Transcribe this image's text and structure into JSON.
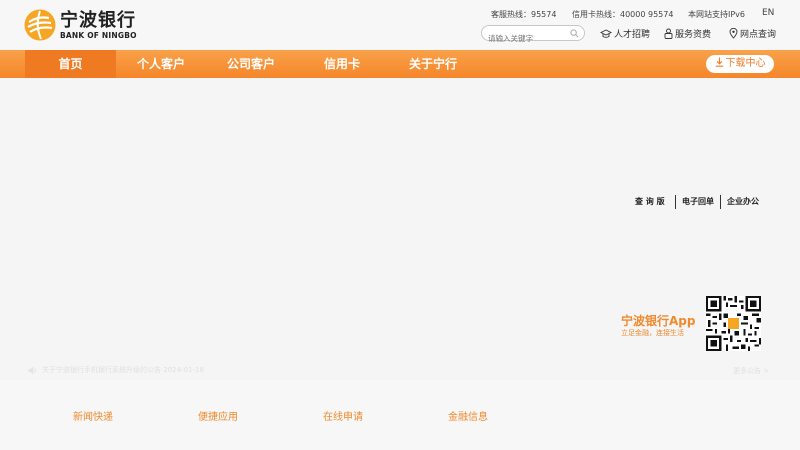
{
  "header": {
    "logo_cn": "宁波银行",
    "logo_en": "BANK OF NINGBO",
    "service_hotline": "客服热线：95574",
    "credit_hotline": "信用卡热线：40000 95574",
    "ipv6": "本网站支持IPv6",
    "lang": "EN",
    "search_placeholder": "请输入关键字",
    "tools": [
      "人才招聘",
      "服务资费",
      "网点查询"
    ]
  },
  "nav": {
    "items": [
      "首页",
      "个人客户",
      "公司客户",
      "信用卡",
      "关于宁行"
    ],
    "active": 0,
    "download_label": "下载中心"
  },
  "hero": {
    "quick_links": [
      "查 询 版",
      "电子回单",
      "企业办公"
    ],
    "app_title": "宁波银行App",
    "app_subtitle": "立足金融，连接生活",
    "notice": "关于宁波银行手机银行系统升级的公告 2024-01-18",
    "more": "更多公告 >"
  },
  "tabs": [
    "新闻快递",
    "便捷应用",
    "在线申请",
    "金融信息"
  ],
  "colors": {
    "accent": "#f5862a",
    "text_accent": "#f08a2e"
  }
}
